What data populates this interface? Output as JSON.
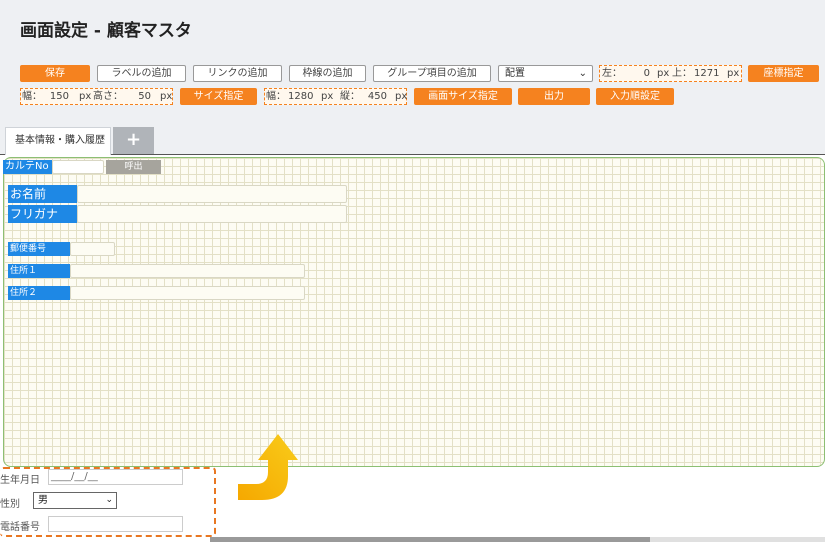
{
  "title": "画面設定 - 顧客マスタ",
  "toolbar": {
    "save": "保存",
    "add_label": "ラベルの追加",
    "add_link": "リンクの追加",
    "add_border": "枠線の追加",
    "add_group_item": "グループ項目の追加",
    "arrange_select": "配置",
    "left_label": "左：",
    "left_value": "0",
    "left_unit": "px",
    "top_label": "上：",
    "top_value": "1271",
    "top_unit": "px",
    "coord_button": "座標指定",
    "width_label": "幅：",
    "width_value": "150",
    "width_unit": "px",
    "height_label": "高さ：",
    "height_value": "50",
    "height_unit": "px",
    "size_button": "サイズ指定",
    "screen_width_label": "幅：",
    "screen_width_value": "1280",
    "screen_width_unit": "px",
    "screen_height_label": "縦：",
    "screen_height_value": "450",
    "screen_height_unit": "px",
    "screen_size_button": "画面サイズ指定",
    "output_button": "出力",
    "input_order_button": "入力順設定"
  },
  "tabs": {
    "active": "基本情報・購入履歴",
    "add": "+"
  },
  "form": {
    "karte_no": "カルテNo",
    "call_button": "呼出",
    "name": "お名前",
    "furigana": "フリガナ",
    "postal_code": "郵便番号",
    "address1": "住所１",
    "address2": "住所２"
  },
  "below": {
    "birthdate_label": "生年月日",
    "birthdate_value": "____/__/__",
    "gender_label": "性別",
    "gender_value": "男",
    "phone_label": "電話番号"
  },
  "colors": {
    "accent_orange": "#f5821f",
    "label_blue": "#1e88e5",
    "arrow_yellow": "#f5b800",
    "grid_border_green": "#8cbf73"
  },
  "icons": {
    "dropdown": "chevron-down-icon",
    "tab_add": "plus-icon",
    "move_arrow": "curved-arrow-up-icon"
  }
}
